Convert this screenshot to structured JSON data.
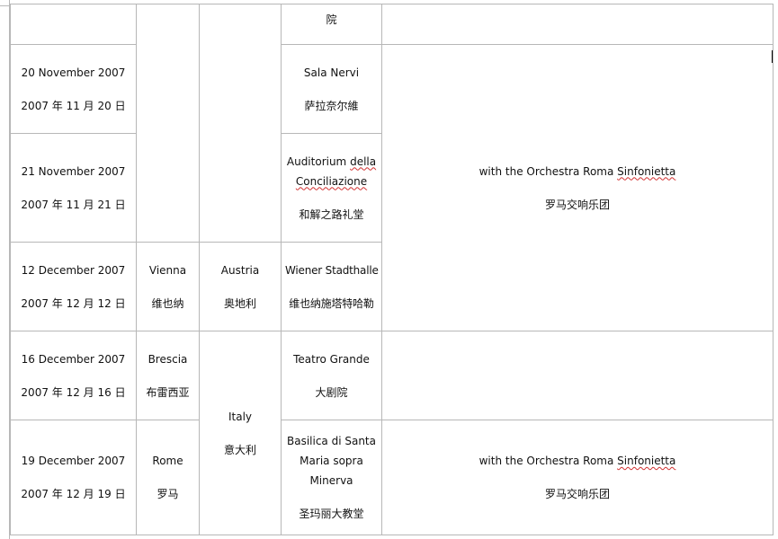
{
  "rows": [
    {
      "venue": {
        "cn": "院"
      }
    },
    {
      "date": {
        "en": "20 November 2007",
        "cn": "2007 年 11 月 20 日"
      },
      "venue": {
        "en": "Sala Nervi",
        "cn": "萨拉奈尔維"
      }
    },
    {
      "date": {
        "en": "21 November 2007",
        "cn": "2007 年 11 月 21 日"
      },
      "venue": {
        "en_1": "Auditorium ",
        "en_1_spell": "della",
        "en_2": "Conciliazione",
        "cn": "和解之路礼堂"
      },
      "note": {
        "en": "with the Orchestra Roma ",
        "en_spell": "Sinfonietta",
        "cn": "罗马交响乐团"
      }
    },
    {
      "date": {
        "en": "12 December 2007",
        "cn": "2007 年 12 月 12 日"
      },
      "city": {
        "en": "Vienna",
        "cn": "维也纳"
      },
      "country": {
        "en": "Austria",
        "cn": "奥地利"
      },
      "venue": {
        "en": "Wiener Stadthalle",
        "cn": "维也纳施塔特哈勒"
      }
    },
    {
      "date": {
        "en": "16 December 2007",
        "cn": "2007 年 12 月 16 日"
      },
      "city": {
        "en": "Brescia",
        "cn": "布雷西亚"
      },
      "country": {
        "en": "Italy",
        "cn": "意大利"
      },
      "venue": {
        "en": "Teatro Grande",
        "cn": "大剧院"
      }
    },
    {
      "date": {
        "en": "19 December 2007",
        "cn": "2007 年 12 月 19 日"
      },
      "city": {
        "en": "Rome",
        "cn": "罗马"
      },
      "venue": {
        "en_1": "Basilica di Santa",
        "en_2": "Maria sopra",
        "en_3": "Minerva",
        "cn": "圣玛丽大教堂"
      },
      "note": {
        "en": "with the Orchestra Roma ",
        "en_spell": "Sinfonietta",
        "cn": "罗马交响乐团"
      }
    }
  ]
}
